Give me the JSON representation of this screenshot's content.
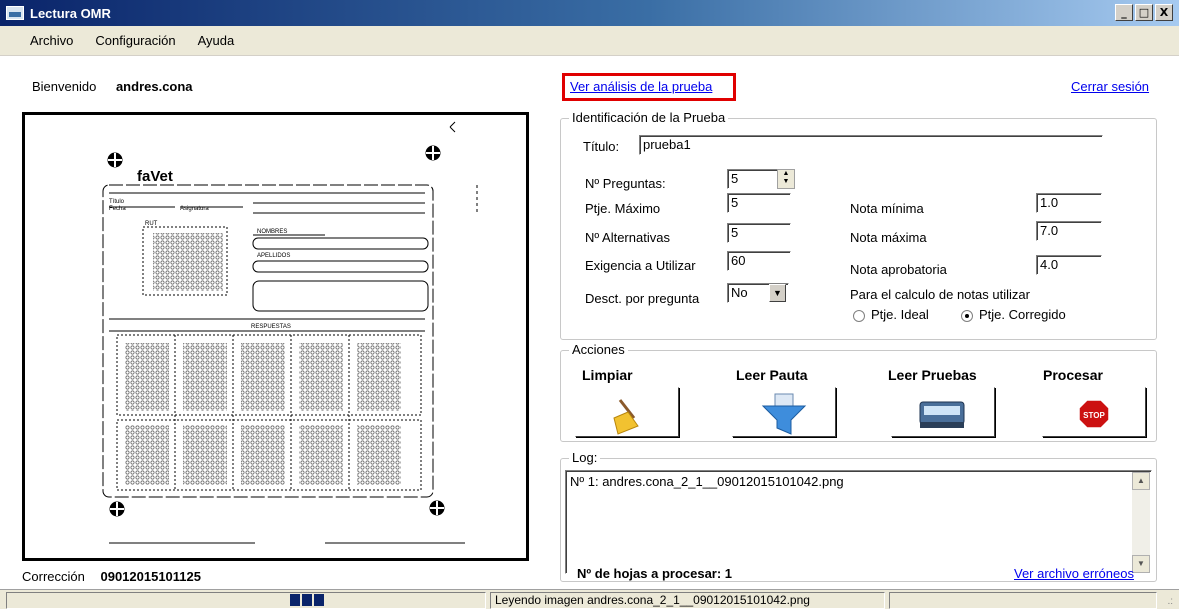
{
  "window": {
    "title": "Lectura OMR",
    "buttons": [
      "_",
      "□",
      "X"
    ]
  },
  "menu": [
    "Archivo",
    "Configuración",
    "Ayuda"
  ],
  "header": {
    "welcome_label": "Bienvenido",
    "username": "andres.cona",
    "analysis_link": "Ver análisis de la prueba",
    "logout_link": "Cerrar sesión"
  },
  "sheet": {
    "logo": "faVet",
    "fields": [
      "Título",
      "Fecha",
      "Asignatura",
      "NOMBRES",
      "APELLIDOS",
      "RUT",
      "RESPUESTAS"
    ]
  },
  "correction": {
    "label": "Corrección",
    "value": "09012015101125"
  },
  "identification": {
    "title": "Identificación de la Prueba",
    "titulo_label": "Título:",
    "titulo_value": "prueba1",
    "preguntas_label": "Nº Preguntas:",
    "preguntas_value": "5",
    "ptje_max_label": "Ptje. Máximo",
    "ptje_max_value": "5",
    "alternativas_label": "Nº Alternativas",
    "alternativas_value": "5",
    "exigencia_label": "Exigencia a Utilizar",
    "exigencia_value": "60",
    "descuento_label": "Desct. por pregunta",
    "descuento_value": "No",
    "nota_min_label": "Nota mínima",
    "nota_min_value": "1.0",
    "nota_max_label": "Nota máxima",
    "nota_max_value": "7.0",
    "nota_apr_label": "Nota aprobatoria",
    "nota_apr_value": "4.0",
    "calc_label": "Para el calculo de notas utilizar",
    "radio_ideal": "Ptje. Ideal",
    "radio_corregido": "Ptje. Corregido",
    "selected": "Ptje. Corregido"
  },
  "actions": {
    "title": "Acciones",
    "limpiar": "Limpiar",
    "leer_pauta": "Leer Pauta",
    "leer_pruebas": "Leer Pruebas",
    "procesar": "Procesar",
    "stop_label": "STOP",
    "icons": [
      "broom-icon",
      "funnel-icon",
      "scanner-icon",
      "stop-sign-icon"
    ]
  },
  "log": {
    "title": "Log:",
    "lines": [
      "Nº 1: andres.cona_2_1__09012015101042.png"
    ]
  },
  "footer": {
    "count_label": "Nº de hojas a procesar: 1",
    "errors_link": "Ver archivo erróneos"
  },
  "statusbar": {
    "message": "Leyendo imagen andres.cona_2_1__09012015101042.png",
    "progress": 0.1
  },
  "colors": {
    "titlebar": "#0a246a",
    "highlight_box": "#e00000",
    "link": "#0000ee",
    "stop": "#cc1111"
  }
}
